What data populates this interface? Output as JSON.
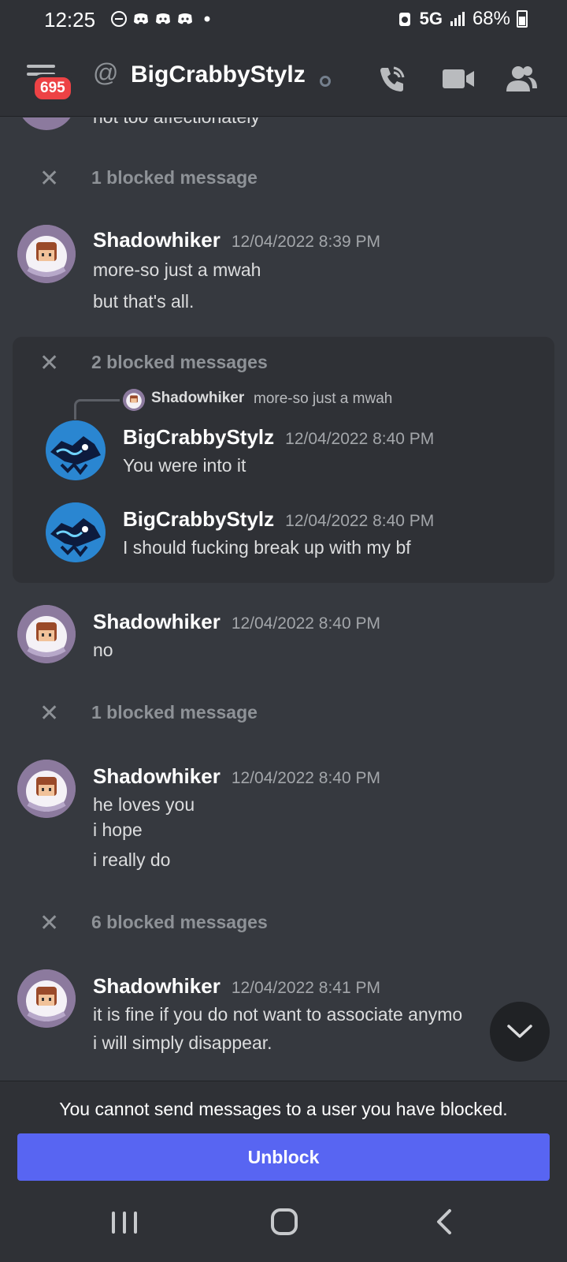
{
  "status_bar": {
    "time": "12:25",
    "network": "5G",
    "battery": "68%"
  },
  "header": {
    "badge_count": "695",
    "at_symbol": "@",
    "title": "BigCrabbyStylz",
    "icons": [
      "menu-icon",
      "voice-call-icon",
      "video-call-icon",
      "members-icon"
    ]
  },
  "messages": {
    "partial_top": "not too affectionately",
    "blocked_1": "1 blocked message",
    "group_1": {
      "author": "Shadowhiker",
      "timestamp": "12/04/2022 8:39 PM",
      "lines": [
        "more-so just a mwah",
        "but that's all."
      ]
    },
    "blocked_2": "2 blocked messages",
    "reply_preview": {
      "author": "Shadowhiker",
      "text": "more-so just a mwah"
    },
    "crab_1": {
      "author": "BigCrabbyStylz",
      "timestamp": "12/04/2022 8:40 PM",
      "text": "You were into it"
    },
    "crab_2": {
      "author": "BigCrabbyStylz",
      "timestamp": "12/04/2022 8:40 PM",
      "text": "I should fucking break up with my bf"
    },
    "group_2": {
      "author": "Shadowhiker",
      "timestamp": "12/04/2022 8:40 PM",
      "lines": [
        "no"
      ]
    },
    "blocked_3": "1 blocked message",
    "group_3": {
      "author": "Shadowhiker",
      "timestamp": "12/04/2022 8:40 PM",
      "lines": [
        "he loves you",
        "i hope",
        "i really do"
      ]
    },
    "blocked_4": "6 blocked messages",
    "group_4": {
      "author": "Shadowhiker",
      "timestamp": "12/04/2022 8:41 PM",
      "lines": [
        "it is fine if you do not want to associate anymo",
        "i will simply disappear."
      ]
    }
  },
  "footer": {
    "notice": "You cannot send messages to a user you have blocked.",
    "unblock_label": "Unblock"
  },
  "colors": {
    "background": "#36393f",
    "header": "#2f3136",
    "accent": "#5865f2",
    "badge": "#ed4245"
  }
}
